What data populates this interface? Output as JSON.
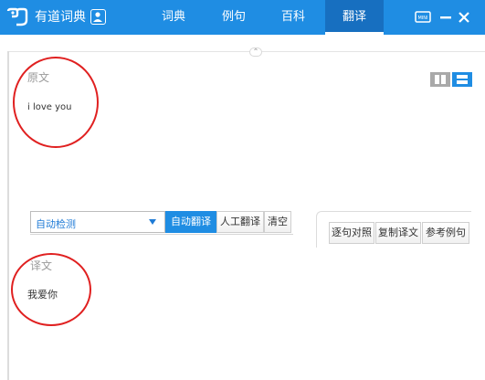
{
  "titlebar": {
    "app_title": "有道词典",
    "tabs": [
      {
        "label": "词典"
      },
      {
        "label": "例句"
      },
      {
        "label": "百科"
      },
      {
        "label": "翻译"
      }
    ],
    "active_tab": "翻译",
    "mini_label": "MINI"
  },
  "source": {
    "label": "原文",
    "text": "i love you"
  },
  "toolbar": {
    "language_select_value": "自动检测",
    "buttons": [
      {
        "label": "自动翻译"
      },
      {
        "label": "人工翻译"
      },
      {
        "label": "清空"
      }
    ],
    "right_buttons": [
      {
        "label": "逐句对照"
      },
      {
        "label": "复制译文"
      },
      {
        "label": "参考例句"
      }
    ]
  },
  "target": {
    "label": "译文",
    "text": "我爱你"
  },
  "colors": {
    "brand_blue": "#1f8de3",
    "annotation_red": "#e02020"
  }
}
